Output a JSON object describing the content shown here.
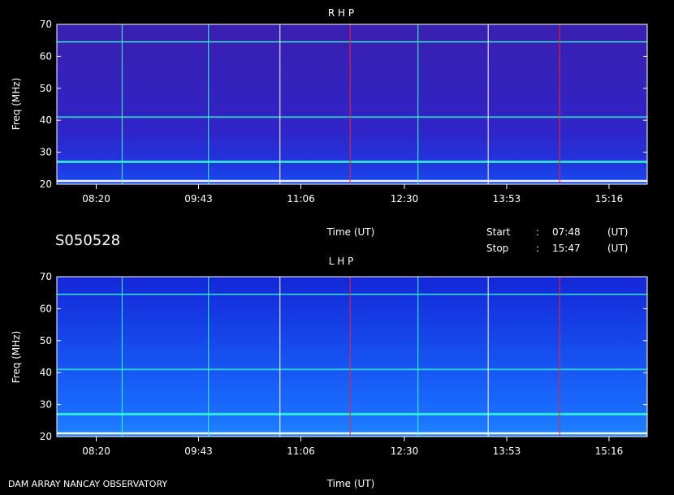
{
  "header": {
    "station_id": "S050528",
    "start_label": "Start",
    "start_sep": ":",
    "start_time": "07:48",
    "start_unit": "(UT)",
    "stop_label": "Stop",
    "stop_sep": ":",
    "stop_time": "15:47",
    "stop_unit": "(UT)"
  },
  "footer": {
    "instrument": "DAM ARRAY  NANCAY OBSERVATORY"
  },
  "colors": {
    "background": "#000000",
    "spectrum_low": "#3322cc",
    "spectrum_mid": "#1f6fff",
    "spectrum_high": "#33ffcc",
    "hot_red": "#ff2222",
    "hot_white": "#ffffff"
  },
  "chart_data": [
    {
      "type": "heatmap",
      "title": "R H P",
      "xlabel": "Time (UT)",
      "ylabel": "Freq (MHz)",
      "ylim": [
        20,
        70
      ],
      "xlim": [
        "07:48",
        "15:47"
      ],
      "x_ticks": [
        "08:20",
        "09:43",
        "11:06",
        "12:30",
        "13:53",
        "15:16"
      ],
      "y_ticks": [
        20,
        30,
        40,
        50,
        60,
        70
      ],
      "horizontal_lines_mhz": [
        64.5,
        41,
        27,
        21
      ],
      "vertical_markers_ut": [
        "08:41",
        "09:51",
        "10:49",
        "11:46",
        "12:41",
        "13:38",
        "14:36"
      ],
      "background_level": "low"
    },
    {
      "type": "heatmap",
      "title": "L H P",
      "xlabel": "Time (UT)",
      "ylabel": "Freq (MHz)",
      "ylim": [
        20,
        70
      ],
      "xlim": [
        "07:48",
        "15:47"
      ],
      "x_ticks": [
        "08:20",
        "09:43",
        "11:06",
        "12:30",
        "13:53",
        "15:16"
      ],
      "y_ticks": [
        20,
        30,
        40,
        50,
        60,
        70
      ],
      "horizontal_lines_mhz": [
        64.5,
        41,
        27,
        21
      ],
      "vertical_markers_ut": [
        "08:41",
        "09:51",
        "10:49",
        "11:46",
        "12:41",
        "13:38",
        "14:36"
      ],
      "background_level": "mid"
    }
  ]
}
